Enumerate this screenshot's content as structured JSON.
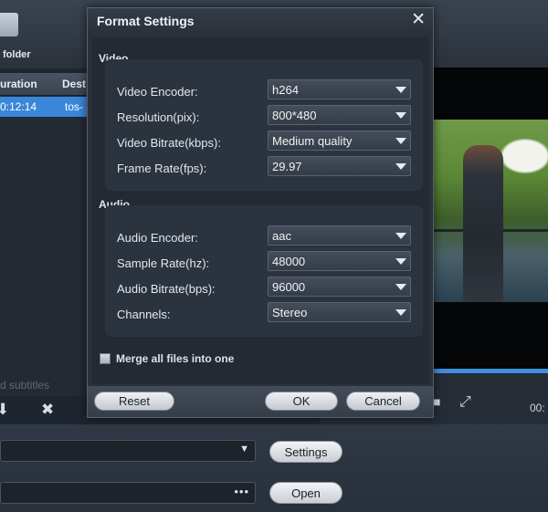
{
  "background": {
    "toolbar": {
      "add_folder_label": "folder"
    },
    "file_list": {
      "headers": [
        "uration",
        "Dest"
      ],
      "rows": [
        {
          "duration": "0:12:14",
          "dest": "tos-"
        }
      ],
      "subtitles_label": "d subtitles"
    },
    "player": {
      "time": "00:"
    },
    "output": {
      "settings_button": "Settings",
      "open_button": "Open",
      "path_dots": "•••"
    }
  },
  "dialog": {
    "title": "Format Settings",
    "close_glyph": "✕",
    "video": {
      "section_title": "Video",
      "fields": [
        {
          "label": "Video Encoder:",
          "value": "h264"
        },
        {
          "label": "Resolution(pix):",
          "value": "800*480"
        },
        {
          "label": "Video Bitrate(kbps):",
          "value": "Medium quality"
        },
        {
          "label": "Frame Rate(fps):",
          "value": "29.97"
        }
      ]
    },
    "audio": {
      "section_title": "Audio",
      "fields": [
        {
          "label": "Audio Encoder:",
          "value": "aac"
        },
        {
          "label": "Sample Rate(hz):",
          "value": "48000"
        },
        {
          "label": "Audio Bitrate(bps):",
          "value": "96000"
        },
        {
          "label": "Channels:",
          "value": "Stereo"
        }
      ]
    },
    "merge_label": "Merge all files into one",
    "merge_checked": false,
    "buttons": {
      "reset": "Reset",
      "ok": "OK",
      "cancel": "Cancel"
    }
  },
  "colors": {
    "accent": "#3a87d9",
    "dialog_bg": "#2a313b",
    "panel_bg": "#232a33"
  }
}
